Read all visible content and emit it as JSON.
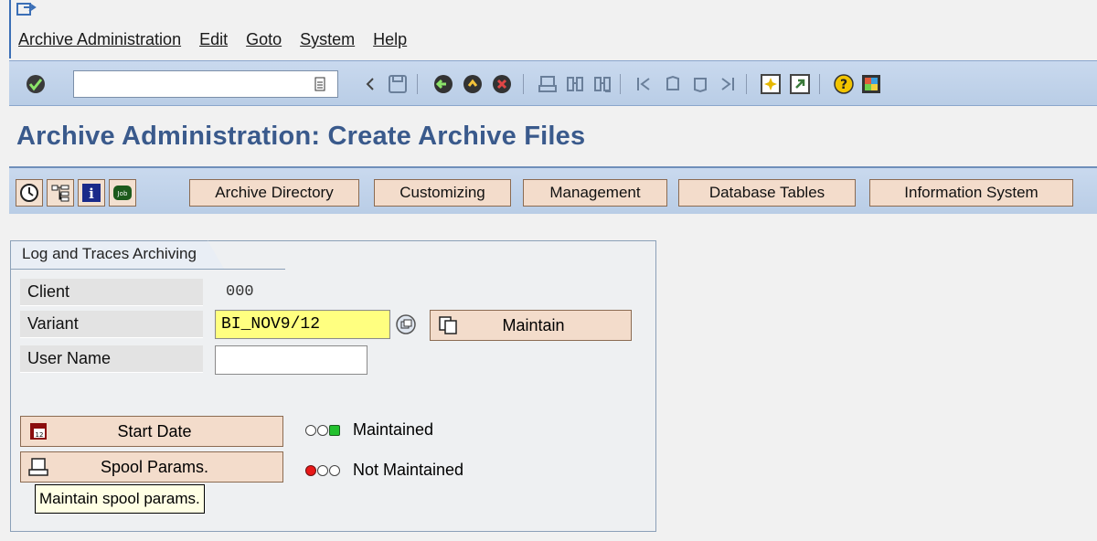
{
  "menu": [
    "Archive Administration",
    "Edit",
    "Goto",
    "System",
    "Help"
  ],
  "toolbar": {
    "command_value": "",
    "icons": [
      "enter-icon",
      "back-arrow-icon",
      "save-icon",
      "back-icon",
      "exit-icon",
      "cancel-icon",
      "print-icon",
      "find-icon",
      "find-next-icon",
      "first-page-icon",
      "previous-page-icon",
      "next-page-icon",
      "last-page-icon",
      "new-session-icon",
      "shortcut-icon",
      "help-icon",
      "layout-icon"
    ]
  },
  "title": "Archive Administration: Create Archive Files",
  "app_toolbar": {
    "icon_buttons": [
      "execute-icon",
      "hierarchy-icon",
      "info-icon",
      "job-icon"
    ],
    "buttons": [
      "Archive Directory",
      "Customizing",
      "Management",
      "Database Tables",
      "Information System"
    ]
  },
  "group": {
    "title": "Log and Traces Archiving",
    "client_label": "Client",
    "client_value": "000",
    "variant_label": "Variant",
    "variant_value": "BI_NOV9/12",
    "maintain_label": "Maintain",
    "username_label": "User Name",
    "username_value": "",
    "start_date_label": "Start Date",
    "spool_label": "Spool Params.",
    "maintained_label": "Maintained",
    "not_maintained_label": "Not Maintained"
  },
  "tooltip": "Maintain spool params.",
  "colors": {
    "title": "#3a5a8c",
    "toolbar": "#c9d9ee",
    "button": "#f3dccb",
    "required_field": "#ffff80"
  }
}
